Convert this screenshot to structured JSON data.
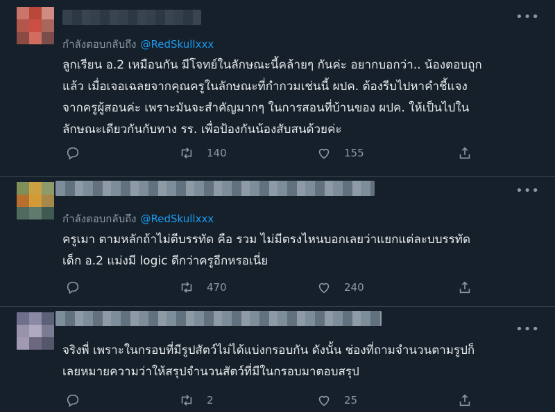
{
  "tweets": [
    {
      "reply_prefix": "กำลังตอบกลับถึง",
      "mention": "@RedSkullxxx",
      "lines": [
        "ลูกเรียน อ.2 เหมือนกัน มีโจทย์ในลักษณะนี้คล้ายๆ กันค่ะ อยากบอกว่า.. น้องตอบถูก",
        "แล้ว เมื่อเจอเฉลยจากคุณครูในลักษณะที่กำกวมเช่นนี้ ผปค. ต้องรีบไปหาคำชี้แจง",
        "จากครูผู้สอนค่ะ เพราะมันจะสำคัญมากๆ ในการสอนที่บ้านของ ผปค. ให้เป็นไปใน",
        "ลักษณะเดียวกันกับทาง รร. เพื่อป้องกันน้องสับสนด้วยค่ะ"
      ],
      "retweets": "140",
      "likes": "155"
    },
    {
      "reply_prefix": "กำลังตอบกลับถึง",
      "mention": "@RedSkullxxx",
      "lines": [
        "ครูเมา ตามหลักถ้าไม่ตีบรรทัด คือ รวม ไม่มีตรงไหนบอกเลยว่าแยกแต่ละบบรรทัด",
        "เด็ก อ.2 แม่งมี logic ดีกว่าครูอีกหรอเนี่ย"
      ],
      "retweets": "470",
      "likes": "240"
    },
    {
      "lines": [
        "จริงพี่ เพราะในกรอบที่มีรูปสัตว์ไม่ได้แบ่งกรอบกัน ดังนั้น ช่องที่ถามจำนวนตามรูปก็",
        "เลยหมายความว่าให้สรุปจำนวนสัตว์ที่มีในกรอบมาตอบสรุป"
      ],
      "retweets": "2",
      "likes": "25"
    }
  ],
  "icons": [
    "reply-icon",
    "retweet-icon",
    "like-icon",
    "share-icon",
    "more-icon"
  ],
  "colors": {
    "background": "#15202b",
    "text": "#e7e9ea",
    "muted": "#8b98a5",
    "link": "#1d9bf0",
    "divider": "#38444d"
  }
}
